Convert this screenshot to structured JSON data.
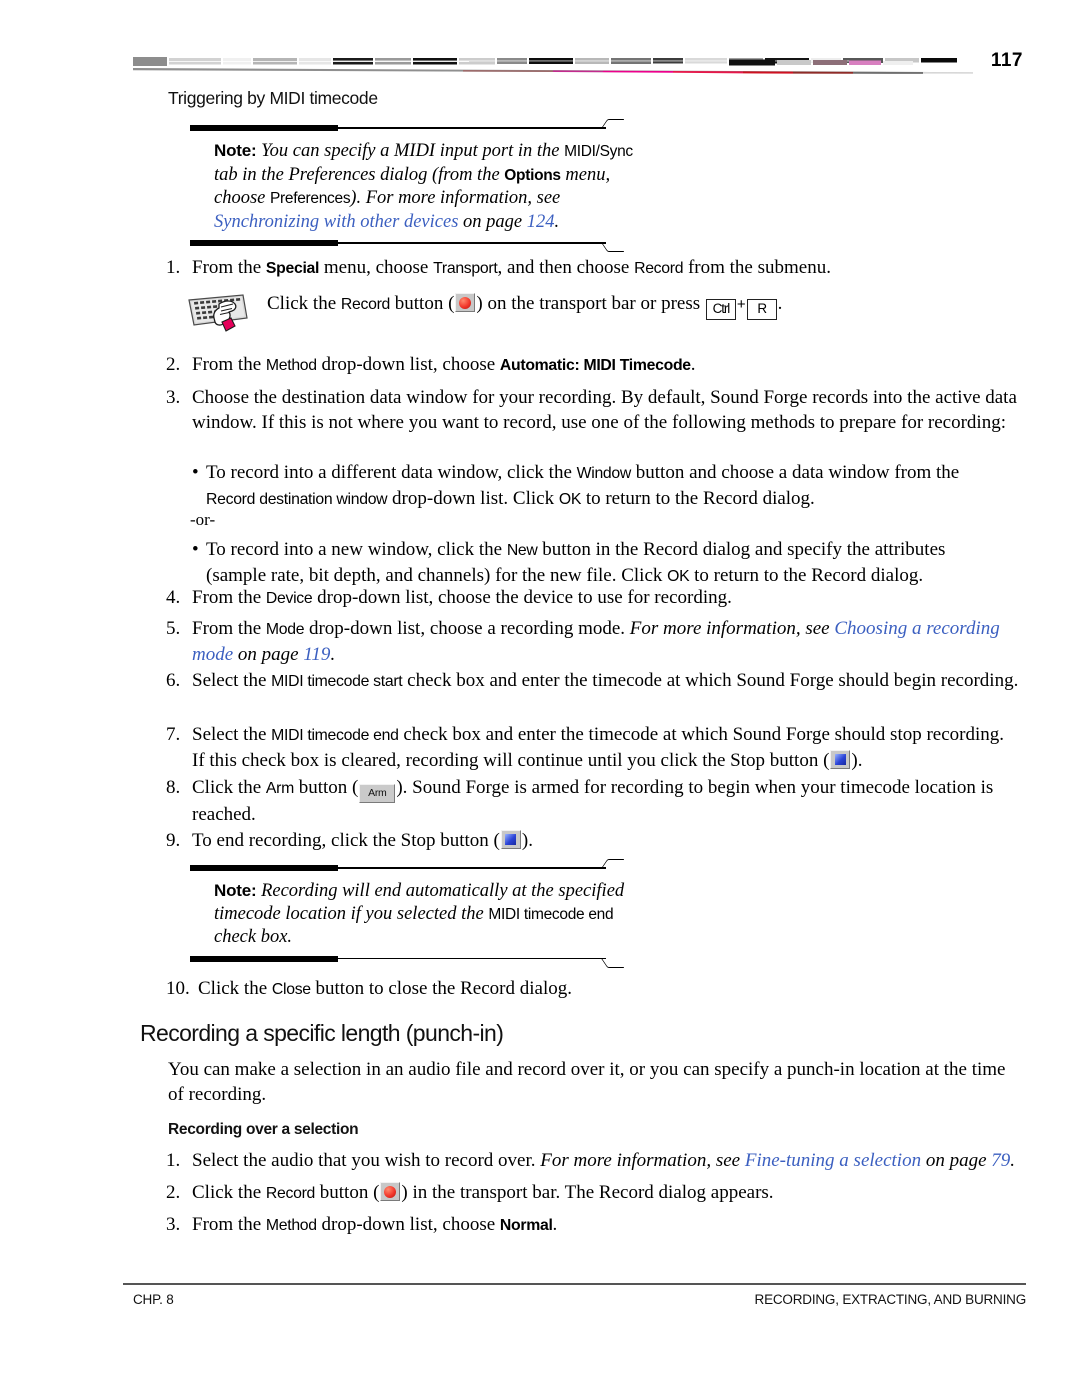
{
  "header": {
    "page_number": "117",
    "decorative_bar": "striped-gradient-rule"
  },
  "section_heading": "Triggering by MIDI timecode",
  "note_1": {
    "label": "Note:",
    "text_parts": [
      {
        "t": "You can specify a MIDI input port in the ",
        "style": "italic"
      },
      {
        "t": "MIDI/Sync",
        "style": "ui"
      },
      {
        "t": " tab in the Preferences dialog (from the ",
        "style": "italic"
      },
      {
        "t": "Options",
        "style": "ui-bold"
      },
      {
        "t": " menu, choose ",
        "style": "italic"
      },
      {
        "t": "Preferences",
        "style": "ui"
      },
      {
        "t": "). For more information, see ",
        "style": "italic"
      }
    ],
    "link_text": "Synchronizing with other devices",
    "link_tail_label": "on page",
    "link_page": "124"
  },
  "steps": [
    {
      "num": "1.",
      "parts": [
        {
          "t": "From the ",
          "style": "serif"
        },
        {
          "t": "Special",
          "style": "ui-bold"
        },
        {
          "t": " menu, choose ",
          "style": "serif"
        },
        {
          "t": "Transport",
          "style": "ui"
        },
        {
          "t": ", and then choose ",
          "style": "serif"
        },
        {
          "t": "Record",
          "style": "ui"
        },
        {
          "t": " from the submenu.",
          "style": "serif"
        }
      ]
    }
  ],
  "tip": {
    "icon": "keyboard-hand-icon",
    "parts": [
      {
        "t": "Click the ",
        "style": "serif"
      },
      {
        "t": "Record",
        "style": "ui"
      },
      {
        "t": " button (",
        "style": "serif"
      },
      {
        "t": "record-button-icon",
        "style": "glyph-record"
      },
      {
        "t": ") on the transport bar or press ",
        "style": "serif"
      },
      {
        "t": "Ctrl",
        "style": "key"
      },
      {
        "t": "+",
        "style": "plus"
      },
      {
        "t": "R",
        "style": "key"
      },
      {
        "t": ".",
        "style": "serif"
      }
    ],
    "key_ctrl": "Ctrl",
    "key_plus": "+",
    "key_r": "R"
  },
  "step2": {
    "num": "2.",
    "parts": [
      {
        "t": "From the ",
        "style": "serif"
      },
      {
        "t": "Method",
        "style": "ui"
      },
      {
        "t": " drop-down list, choose ",
        "style": "serif"
      },
      {
        "t": "Automatic: MIDI Timecode",
        "style": "ui"
      },
      {
        "t": ".",
        "style": "serif"
      }
    ]
  },
  "step3": {
    "num": "3.",
    "text": "Choose the destination data window for your recording. By default, Sound Forge records into the active data window. If this is not where you want to record, use one of the following methods to prepare for recording:"
  },
  "bullet1": {
    "dot": "•",
    "parts": [
      {
        "t": "To record into a different data window, click the ",
        "style": "serif"
      },
      {
        "t": "Window",
        "style": "ui"
      },
      {
        "t": " button and choose a data window from the ",
        "style": "serif"
      },
      {
        "t": "Record destination window",
        "style": "ui"
      },
      {
        "t": " drop-down list. Click ",
        "style": "serif"
      },
      {
        "t": "OK",
        "style": "ui"
      },
      {
        "t": " to return to the Record dialog.",
        "style": "serif"
      }
    ]
  },
  "or_label": "-or-",
  "bullet2": {
    "dot": "•",
    "parts": [
      {
        "t": "To record into a new window, click the ",
        "style": "serif"
      },
      {
        "t": "New",
        "style": "ui"
      },
      {
        "t": " button in the Record dialog and specify the attributes (sample rate, bit depth, and channels) for the new file. Click ",
        "style": "serif"
      },
      {
        "t": "OK",
        "style": "ui"
      },
      {
        "t": " to return to the Record dialog.",
        "style": "serif"
      }
    ]
  },
  "step4": {
    "num": "4.",
    "parts": [
      {
        "t": "From the ",
        "style": "serif"
      },
      {
        "t": "Device",
        "style": "ui"
      },
      {
        "t": " drop-down list, choose the device to use for recording.",
        "style": "serif"
      }
    ]
  },
  "step5": {
    "num": "5.",
    "parts": [
      {
        "t": "From the ",
        "style": "serif"
      },
      {
        "t": "Mode",
        "style": "ui"
      },
      {
        "t": " drop-down list, choose a recording mode. ",
        "style": "serif"
      },
      {
        "t": "For more information, see ",
        "style": "italic"
      }
    ],
    "link_text": "Choosing a recording mode",
    "link_tail_label": "on page",
    "link_page": "119"
  },
  "step6": {
    "num": "6.",
    "parts": [
      {
        "t": "Select the ",
        "style": "serif"
      },
      {
        "t": "MIDI timecode start",
        "style": "ui"
      },
      {
        "t": " check box and enter the timecode at which Sound Forge should begin recording.",
        "style": "serif"
      }
    ]
  },
  "step7": {
    "num": "7.",
    "parts": [
      {
        "t": "Select the ",
        "style": "serif"
      },
      {
        "t": "MIDI timecode end",
        "style": "ui"
      },
      {
        "t": " check box and enter the timecode at which Sound Forge should stop recording. If this check box is cleared, recording will continue until you click the Stop button (",
        "style": "serif"
      },
      {
        "t": "stop-button-icon",
        "style": "glyph-stop"
      },
      {
        "t": ").",
        "style": "serif"
      }
    ]
  },
  "step8": {
    "num": "8.",
    "arm_label": "Arm",
    "parts": [
      {
        "t": "Click the ",
        "style": "serif"
      },
      {
        "t": "Arm",
        "style": "ui"
      },
      {
        "t": " button (",
        "style": "serif"
      },
      {
        "t": "arm-button-icon",
        "style": "glyph-arm"
      },
      {
        "t": "). Sound Forge is armed for recording to begin when your timecode location is reached.",
        "style": "serif"
      }
    ]
  },
  "step9": {
    "num": "9.",
    "parts": [
      {
        "t": "To end recording, click the Stop button (",
        "style": "serif"
      },
      {
        "t": "stop-button-icon",
        "style": "glyph-stop"
      },
      {
        "t": ").",
        "style": "serif"
      }
    ]
  },
  "note_2": {
    "label": "Note:",
    "text_parts": [
      {
        "t": "Recording will end automatically at the specified timecode location if you selected the ",
        "style": "italic"
      },
      {
        "t": "MIDI timecode end",
        "style": "ui"
      },
      {
        "t": " check box.",
        "style": "italic"
      }
    ]
  },
  "step10": {
    "num": "10.",
    "parts": [
      {
        "t": "Click the ",
        "style": "serif"
      },
      {
        "t": "Close",
        "style": "ui"
      },
      {
        "t": " button to close the Record dialog.",
        "style": "serif"
      }
    ]
  },
  "major_heading": "Recording a specific length (punch-in)",
  "intro_paragraph": "You can make a selection in an audio file and record over it, or you can specify a punch-in location at the time of recording.",
  "minor_heading": "Recording over a selection",
  "sel_step1": {
    "num": "1.",
    "parts": [
      {
        "t": "Select the audio that you wish to record over. ",
        "style": "serif"
      },
      {
        "t": "For more information, see ",
        "style": "italic"
      }
    ],
    "link_text": "Fine-tuning a selection",
    "link_tail_label": "on page",
    "link_page": "79"
  },
  "sel_step2": {
    "num": "2.",
    "parts": [
      {
        "t": "Click the ",
        "style": "serif"
      },
      {
        "t": "Record",
        "style": "ui"
      },
      {
        "t": " button (",
        "style": "serif"
      },
      {
        "t": "record-button-icon",
        "style": "glyph-record"
      },
      {
        "t": ") in the transport bar. The Record dialog appears.",
        "style": "serif"
      }
    ]
  },
  "sel_step3": {
    "num": "3.",
    "parts": [
      {
        "t": "From the ",
        "style": "serif"
      },
      {
        "t": "Method",
        "style": "ui"
      },
      {
        "t": " drop-down list, choose ",
        "style": "serif"
      },
      {
        "t": "Normal",
        "style": "ui"
      },
      {
        "t": ".",
        "style": "serif"
      }
    ]
  },
  "footer": {
    "left": "CHP. 8",
    "right": "RECORDING, EXTRACTING, AND BURNING"
  },
  "colors": {
    "link": "#3b5fc0",
    "record_red": "#f2372b",
    "stop_blue": "#2a43d6",
    "rule": "#555555",
    "accent_magenta": "#ec008c",
    "accent_crimson": "#e8174a"
  }
}
